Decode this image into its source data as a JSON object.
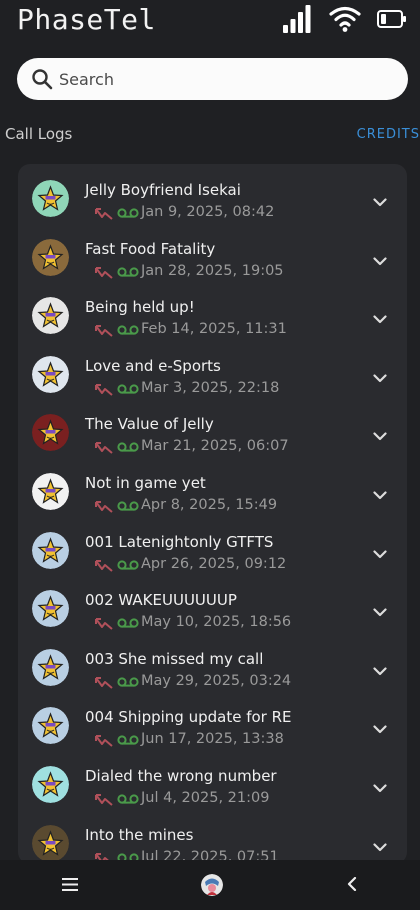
{
  "app": {
    "title": "PhaseTel"
  },
  "search": {
    "placeholder": "Search"
  },
  "section": {
    "title": "Call Logs",
    "credits_label": "CREDITS"
  },
  "calls": [
    {
      "title": "Jelly Boyfriend Isekai",
      "date": "Jan 9, 2025, 08:42",
      "avatar_bg": "#8fd6b8"
    },
    {
      "title": "Fast Food Fatality",
      "date": "Jan 28, 2025, 19:05",
      "avatar_bg": "#8a6a3c"
    },
    {
      "title": "Being held up!",
      "date": "Feb 14, 2025, 11:31",
      "avatar_bg": "#e6e6e6"
    },
    {
      "title": "Love and e-Sports",
      "date": "Mar 3, 2025, 22:18",
      "avatar_bg": "#dfe6ee"
    },
    {
      "title": "The Value of Jelly",
      "date": "Mar 21, 2025, 06:07",
      "avatar_bg": "#7a2020"
    },
    {
      "title": "Not in game yet",
      "date": "Apr 8, 2025, 15:49",
      "avatar_bg": "#f2f2f2"
    },
    {
      "title": "001 Latenightonly GTFTS",
      "date": "Apr 26, 2025, 09:12",
      "avatar_bg": "#b9cfe3"
    },
    {
      "title": "002 WAKEUUUUUUP",
      "date": "May 10, 2025, 18:56",
      "avatar_bg": "#b9cfe3"
    },
    {
      "title": "003 She missed my call",
      "date": "May 29, 2025, 03:24",
      "avatar_bg": "#b9cfe3"
    },
    {
      "title": "004 Shipping update for RE",
      "date": "Jun 17, 2025, 13:38",
      "avatar_bg": "#b9cfe3"
    },
    {
      "title": "Dialed the wrong number",
      "date": "Jul 4, 2025, 21:09",
      "avatar_bg": "#9fe0e0"
    },
    {
      "title": "Into the mines",
      "date": "Jul 22, 2025, 07:51",
      "avatar_bg": "#5a4a30"
    }
  ],
  "colors": {
    "missed_call": "#b0505a",
    "voicemail": "#4a9a4a",
    "accent": "#3a8fd8"
  },
  "icons": {
    "missed": "missed-call-icon",
    "voicemail": "voicemail-icon",
    "expand": "chevron-down-icon"
  }
}
